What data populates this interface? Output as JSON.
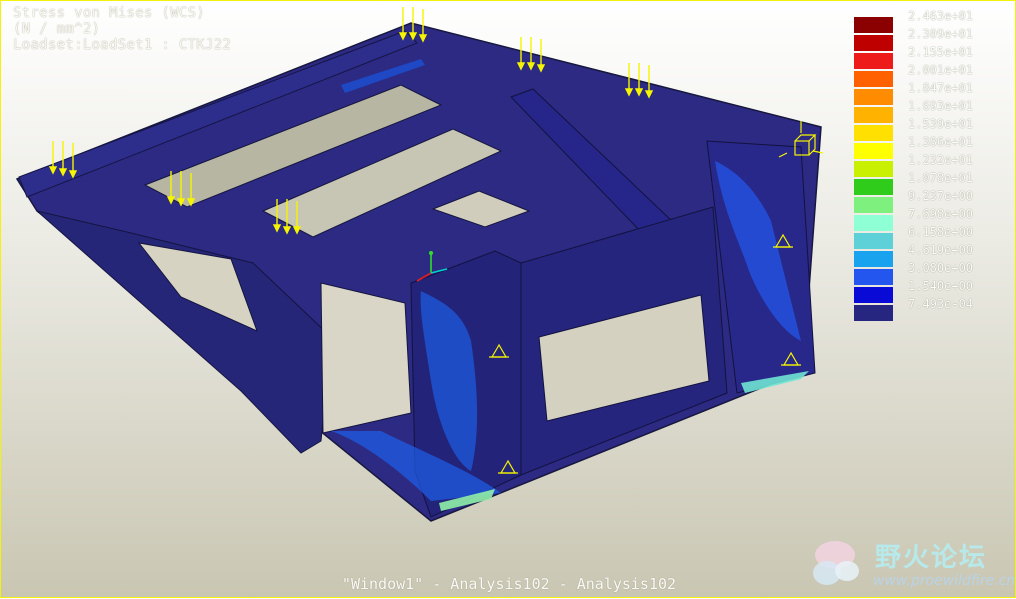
{
  "header": {
    "line1": "Stress von Mises (WCS)",
    "line2": "(N / mm^2)",
    "line3": "Loadset:LoadSet1 :  CTKJ22"
  },
  "legend": {
    "entries": [
      {
        "label": "2.463e+01",
        "color": "#8b0000"
      },
      {
        "label": "2.309e+01",
        "color": "#bf0000"
      },
      {
        "label": "2.155e+01",
        "color": "#ee1b1b"
      },
      {
        "label": "2.001e+01",
        "color": "#ff6000"
      },
      {
        "label": "1.847e+01",
        "color": "#ff8c00"
      },
      {
        "label": "1.693e+01",
        "color": "#ffb300"
      },
      {
        "label": "1.539e+01",
        "color": "#ffe000"
      },
      {
        "label": "1.386e+01",
        "color": "#ffff00"
      },
      {
        "label": "1.232e+01",
        "color": "#c8f000"
      },
      {
        "label": "1.078e+01",
        "color": "#2fcc1c"
      },
      {
        "label": "9.237e+00",
        "color": "#7ef07e"
      },
      {
        "label": "7.698e+00",
        "color": "#8fffd6"
      },
      {
        "label": "6.158e+00",
        "color": "#5ed0d8"
      },
      {
        "label": "4.619e+00",
        "color": "#19a3ef"
      },
      {
        "label": "3.080e+00",
        "color": "#2356ef"
      },
      {
        "label": "1.540e+00",
        "color": "#0a0ad6"
      },
      {
        "label": "7.493e-04",
        "color": "#262680"
      }
    ]
  },
  "footer": "\"Window1\" - Analysis102 - Analysis102",
  "watermark": {
    "title": "野火论坛",
    "url": "www.proewildfire.cn"
  },
  "colors": {
    "frame": "#f2f20a",
    "mesh_base": "#2a2a7a",
    "load_arrow": "#f5f500"
  },
  "icons": [
    "load-arrow-icon",
    "constraint-icon",
    "csys-triad-icon",
    "csys-box-icon",
    "watermark-logo-icon"
  ]
}
